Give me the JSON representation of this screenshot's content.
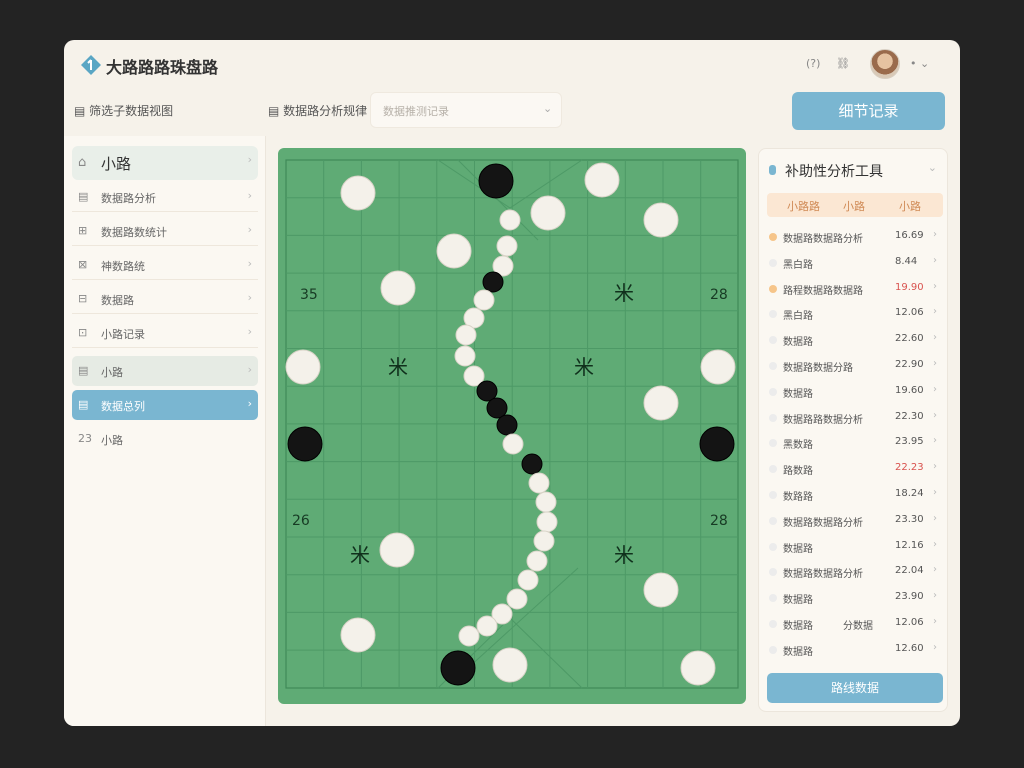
{
  "colors": {
    "accent": "#7ab6d1",
    "board": "#5fab75",
    "active_dot": "#f6c58a",
    "highlight_value": "#d9534f"
  },
  "app": {
    "title": "大路路路珠盘路"
  },
  "topbar": {
    "help_icon": "(?)",
    "share_icon": "⛓",
    "user_menu": "•  ⌄"
  },
  "toolbar": {
    "filter1_label": "▤ 筛选子数据视图",
    "filter2_label": "▤ 数据路分析规律",
    "select_placeholder": "数据推测记录",
    "primary_button": "细节记录"
  },
  "sidebar": {
    "header": {
      "icon": "⌂",
      "label": "小路"
    },
    "items": [
      {
        "icon": "▤",
        "label": "数据路分析"
      },
      {
        "icon": "⊞",
        "label": "数据路数统计"
      },
      {
        "icon": "⊠",
        "label": "神数路统"
      },
      {
        "icon": "⊟",
        "label": "数据路"
      },
      {
        "icon": "⊡",
        "label": "小路记录"
      },
      {
        "icon": "▤",
        "label": "小路"
      },
      {
        "icon": "▤",
        "label": "数据总列"
      },
      {
        "icon": "23",
        "label": "小路"
      }
    ]
  },
  "board": {
    "labels": {
      "tl": "35",
      "tr": "28",
      "bl": "26",
      "br": "28"
    },
    "mark": "米"
  },
  "panel": {
    "title": "补助性分析工具",
    "columns": [
      "小路路",
      "小路",
      "小路"
    ],
    "rows": [
      {
        "name": "数据路数据路分析",
        "value": "16.69",
        "active": true
      },
      {
        "name": "黑白路",
        "value": "8.44",
        "active": false
      },
      {
        "name": "路程数据路数据路",
        "value": "19.90",
        "active": true,
        "highlight": true
      },
      {
        "name": "黑白路",
        "value": "12.06",
        "active": false
      },
      {
        "name": "数据路",
        "value": "22.60",
        "active": false
      },
      {
        "name": "数据路数据分路",
        "value": "22.90",
        "active": false
      },
      {
        "name": "数据路",
        "value": "19.60",
        "active": false
      },
      {
        "name": "数据路路数据分析",
        "value": "22.30",
        "active": false
      },
      {
        "name": "黑数路",
        "value": "23.95",
        "active": false
      },
      {
        "name": "路数路",
        "value": "22.23",
        "active": false,
        "highlight": true
      },
      {
        "name": "数路路",
        "value": "18.24",
        "active": false
      },
      {
        "name": "数据路数据路分析",
        "value": "23.30",
        "active": false
      },
      {
        "name": "数据路",
        "value": "12.16",
        "active": false
      },
      {
        "name": "数据路数据路分析",
        "value": "22.04",
        "active": false
      },
      {
        "name": "数据路",
        "value": "23.90",
        "active": false
      },
      {
        "name": "数据路",
        "value": "12.06",
        "active": false,
        "extra": "分数据"
      },
      {
        "name": "数据路",
        "value": "12.60",
        "active": false
      }
    ],
    "button": "路线数据"
  }
}
